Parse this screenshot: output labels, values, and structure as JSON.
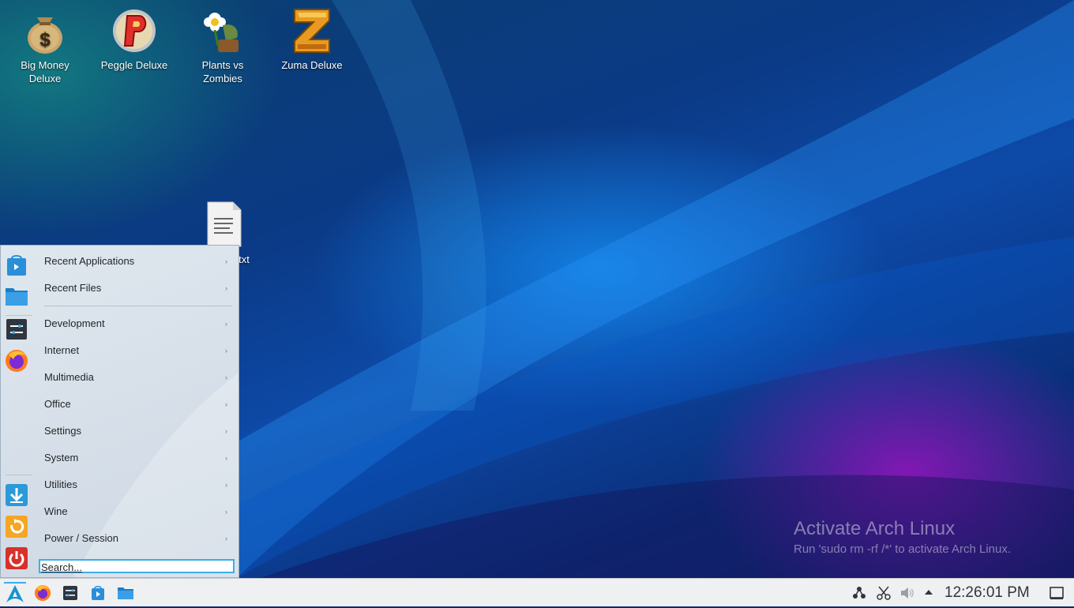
{
  "desktop": {
    "icons": [
      {
        "label": "Big Money Deluxe",
        "line1": "Big Money",
        "line2": "Deluxe"
      },
      {
        "label": "Peggle Deluxe",
        "line1": "Peggle Deluxe",
        "line2": ""
      },
      {
        "label": "Plants vs Zombies",
        "line1": "Plants vs",
        "line2": "Zombies"
      },
      {
        "label": "Zuma Deluxe",
        "line1": "Zuma Deluxe",
        "line2": ""
      },
      {
        "label": "Text File.txt",
        "line1": "Text File.txt",
        "line2": ""
      }
    ]
  },
  "menu": {
    "items": [
      {
        "label": "Recent Applications",
        "has_submenu": true
      },
      {
        "label": "Recent Files",
        "has_submenu": true
      },
      {
        "label": "Development",
        "has_submenu": true
      },
      {
        "label": "Internet",
        "has_submenu": true
      },
      {
        "label": "Multimedia",
        "has_submenu": true
      },
      {
        "label": "Office",
        "has_submenu": true
      },
      {
        "label": "Settings",
        "has_submenu": true
      },
      {
        "label": "System",
        "has_submenu": true
      },
      {
        "label": "Utilities",
        "has_submenu": true
      },
      {
        "label": "Wine",
        "has_submenu": true
      },
      {
        "label": "Power / Session",
        "has_submenu": true
      }
    ],
    "submenu_arrow": "›",
    "search": {
      "placeholder": "Search...",
      "value": ""
    },
    "side_icons": [
      "discover-store-icon",
      "folder-icon",
      "terminal-settings-icon",
      "firefox-icon",
      "download-icon",
      "update-icon",
      "power-icon"
    ]
  },
  "taskbar": {
    "launcher_icon": "arch-logo-icon",
    "pinned": [
      "firefox-icon",
      "terminal-settings-icon",
      "discover-store-icon",
      "folder-icon"
    ],
    "tray": [
      "network-icon",
      "clipboard-scissors-icon",
      "volume-icon",
      "expand-arrow-icon"
    ],
    "clock": "12:26:01 PM",
    "show_desktop_icon": "show-desktop-icon"
  },
  "watermark": {
    "title": "Activate Arch Linux",
    "subtitle": "Run 'sudo rm -rf /*' to activate Arch Linux."
  },
  "colors": {
    "accent": "#3daee9",
    "taskbar_bg": "#eff0f1",
    "menu_bg": "#dfe7ee"
  }
}
